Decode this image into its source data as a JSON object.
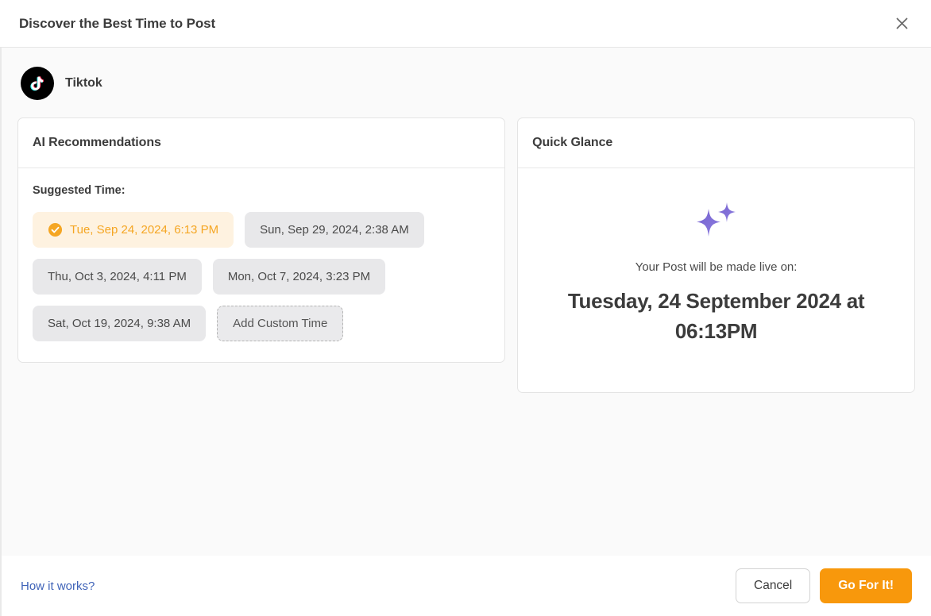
{
  "header": {
    "title": "Discover the Best Time to Post",
    "close_icon": "close-icon"
  },
  "platform": {
    "name": "Tiktok",
    "logo_icon": "tiktok-logo-icon"
  },
  "ai_panel": {
    "title": "AI Recommendations",
    "suggested_label": "Suggested Time:",
    "chips": [
      {
        "label": "Tue, Sep 24, 2024, 6:13 PM",
        "selected": true,
        "variant": "selected",
        "icon": "check-circle-icon"
      },
      {
        "label": "Sun, Sep 29, 2024, 2:38 AM",
        "selected": false,
        "variant": "default"
      },
      {
        "label": "Thu, Oct 3, 2024, 4:11 PM",
        "selected": false,
        "variant": "default"
      },
      {
        "label": "Mon, Oct 7, 2024, 3:23 PM",
        "selected": false,
        "variant": "default"
      },
      {
        "label": "Sat, Oct 19, 2024, 9:38 AM",
        "selected": false,
        "variant": "default"
      },
      {
        "label": "Add Custom Time",
        "selected": false,
        "variant": "dashed"
      }
    ]
  },
  "glance_panel": {
    "title": "Quick Glance",
    "sparkle_icon": "sparkles-icon",
    "subtitle": "Your Post will be made live on:",
    "datetime": "Tuesday, 24 September 2024 at 06:13PM"
  },
  "footer": {
    "how_it_works": "How it works?",
    "cancel_label": "Cancel",
    "primary_label": "Go For It!"
  },
  "colors": {
    "accent_orange": "#f8980c",
    "selected_chip_bg": "#fef2e0",
    "selected_chip_text": "#f5a623",
    "chip_bg": "#e8e8ea",
    "link_blue": "#3f63b8",
    "sparkle_purple": "#7b68d4",
    "body_bg": "#fafafa"
  }
}
